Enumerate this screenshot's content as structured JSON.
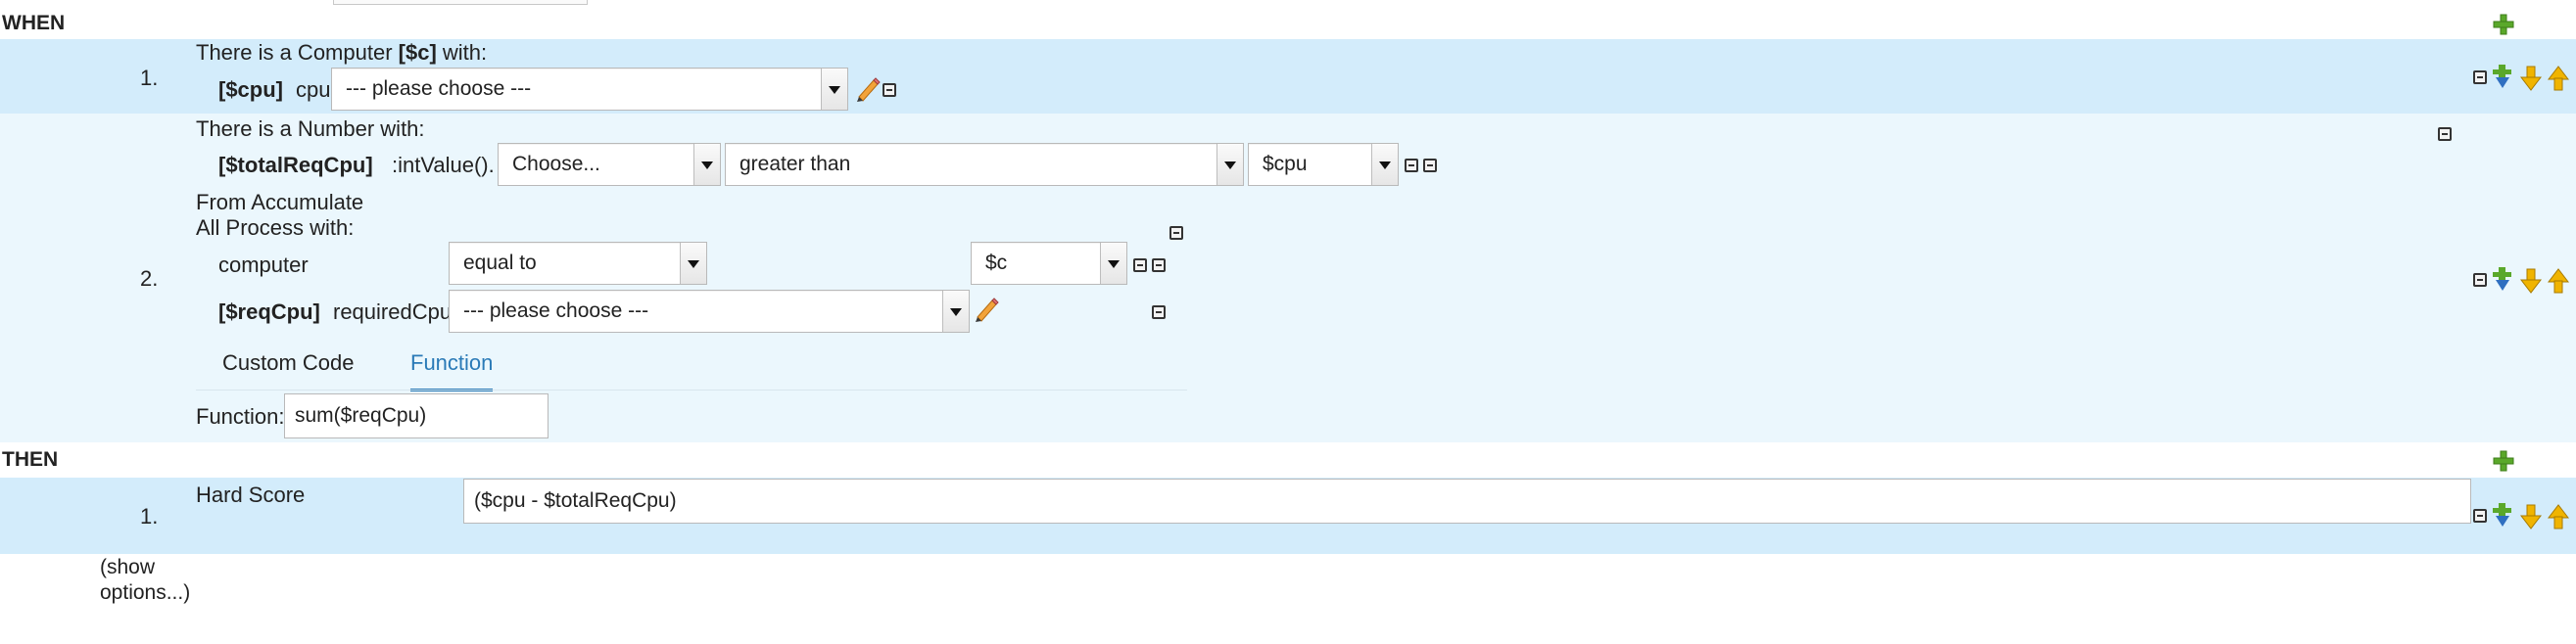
{
  "when": {
    "label": "WHEN",
    "rules": [
      {
        "number": "1.",
        "pattern_title_prefix": "There is a Computer",
        "pattern_binding": "[$c]",
        "pattern_title_suffix": "with:",
        "field_binding": "[$cpu]",
        "field_name": "cpu",
        "field_select": "--- please choose ---"
      },
      {
        "number": "2.",
        "pattern_title": "There is a Number with:",
        "total_binding": "[$totalReqCpu]",
        "total_method": ":intValue().",
        "choose_select": "Choose...",
        "operator_select": "greater than",
        "value_select": "$cpu",
        "from_accumulate": "From Accumulate",
        "all_process": "All Process with:",
        "computer_label": "computer",
        "computer_operator": "equal to",
        "computer_value": "$c",
        "req_binding": "[$reqCpu]",
        "req_field": "requiredCpu",
        "req_select": "--- please choose ---",
        "tabs": [
          "Custom Code",
          "Function"
        ],
        "function_label": "Function:",
        "function_value": "sum($reqCpu)"
      }
    ]
  },
  "then": {
    "label": "THEN",
    "rules": [
      {
        "number": "1.",
        "label": "Hard Score",
        "value": "($cpu - $totalReqCpu)"
      }
    ]
  },
  "show_options": "(show\noptions...)",
  "colors": {
    "band_dark": "#d3ecfb",
    "band_light": "#ebf7fd",
    "tab_active": "#2a7ab7",
    "plus_green": "#5aa82a",
    "arrow_yellow": "#f0b400",
    "arrow_blue": "#2f6fc0"
  }
}
